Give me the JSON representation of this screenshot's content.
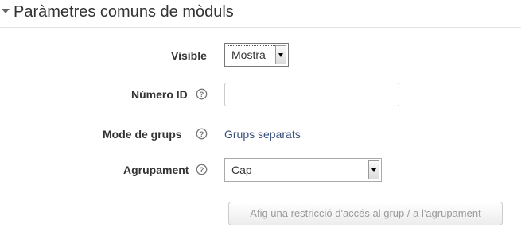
{
  "section": {
    "title": "Paràmetres comuns de mòduls",
    "collapse_icon": "chevron-down-icon"
  },
  "fields": {
    "visible": {
      "label": "Visible",
      "value": "Mostra"
    },
    "id_number": {
      "label": "Número ID",
      "value": "",
      "help_icon": "question-circle-icon"
    },
    "group_mode": {
      "label": "Mode de grups",
      "value": "Grups separats",
      "help_icon": "question-circle-icon"
    },
    "grouping": {
      "label": "Agrupament",
      "value": "Cap",
      "help_icon": "question-circle-icon"
    }
  },
  "restrict_button": {
    "label": "Afig una restricció d'accés al grup / a l'agrupament",
    "enabled": false
  },
  "colors": {
    "link_text": "#3a4f7a",
    "disabled_text": "#9a9a9a",
    "label_text": "#333333"
  }
}
